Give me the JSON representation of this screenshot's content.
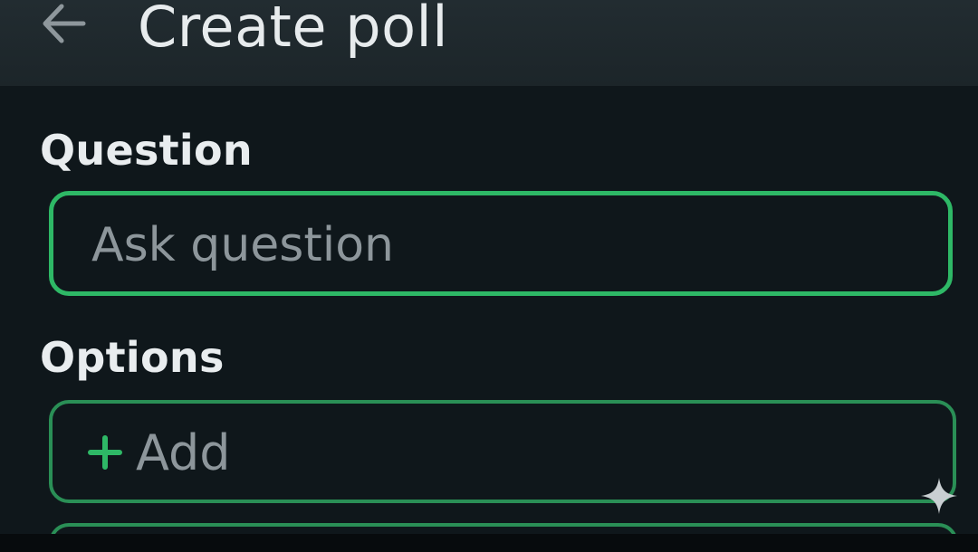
{
  "app_bar": {
    "title": "Create poll",
    "back_icon": "arrow-left-icon"
  },
  "question": {
    "label": "Question",
    "input_value": "",
    "placeholder": "Ask question"
  },
  "options": {
    "label": "Options",
    "add_label": "Add",
    "add_icon": "plus-icon"
  },
  "overlay": {
    "icon": "sparkle-icon"
  },
  "colors": {
    "accent": "#2eb866",
    "background": "#0f171b",
    "app_bar": "#1f292d",
    "text_primary": "#e9edef",
    "text_hint": "#8d969b"
  }
}
